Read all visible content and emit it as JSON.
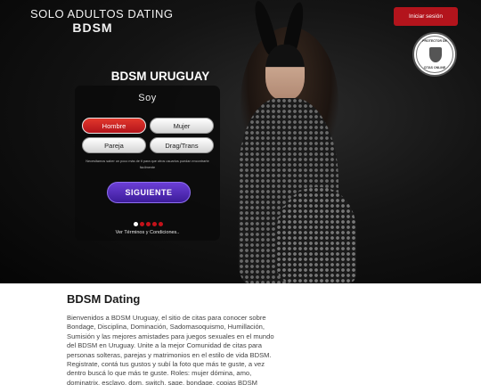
{
  "header": {
    "logo_top": "SOLO ADULTOS DATING",
    "logo_bottom": "BDSM",
    "login_label": "Iniciar sesión",
    "seal_top": "PROTECTOR DE",
    "seal_bottom": "CITAS ONLINE",
    "seal_icon": "shield-icon"
  },
  "hero": {
    "title": "BDSM URUGUAY",
    "question": "Soy",
    "options": [
      "Hombre",
      "Mujer",
      "Pareja",
      "Drag/Trans"
    ],
    "selected_option": "Hombre",
    "hint": "Necesitamos saber un poco más de ti para que otros usuarios puedan encontrarte fácilmente",
    "next_label": "SIGUIENTE",
    "steps_total": 5,
    "current_step": 1,
    "terms_prefix": "Ver ",
    "terms_link": "Términos y Condiciones..",
    "accent": "#b3141c",
    "button_color": "#5a2fc4"
  },
  "content": {
    "title": "BDSM Dating",
    "text": "Bienvenidos a BDSM Uruguay, el sitio de citas para conocer sobre Bondage, Disciplina, Dominación, Sadomasoquismo, Humillación, Sumisión y las mejores amistades para juegos sexuales en el mundo del BDSM en Uruguay. Unite a la mejor Comunidad de citas para personas solteras, parejas y matrimonios en el estilo de vida BDSM. Registrate, contá tus gustos y subí la foto que más te guste, a vez dentro buscá lo que más te guste. Roles: mujer dómina, amo, dominatrix, esclavo, dom, switch, sage, bondage, copias BDSM"
  }
}
